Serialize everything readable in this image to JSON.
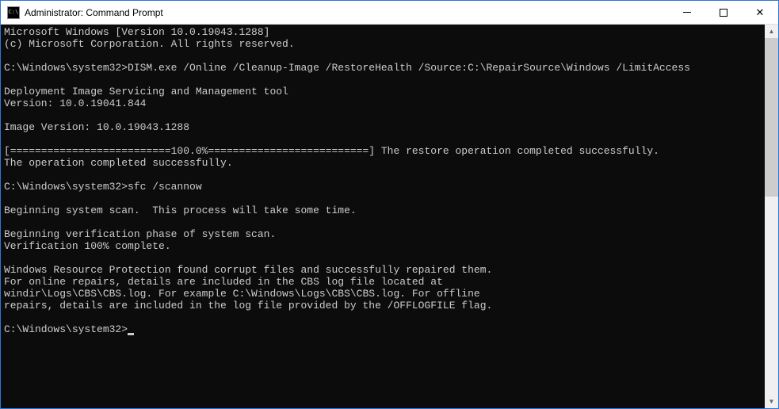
{
  "window": {
    "title": "Administrator: Command Prompt",
    "icon_text": "C:\\"
  },
  "terminal": {
    "lines": [
      "Microsoft Windows [Version 10.0.19043.1288]",
      "(c) Microsoft Corporation. All rights reserved.",
      "",
      "C:\\Windows\\system32>DISM.exe /Online /Cleanup-Image /RestoreHealth /Source:C:\\RepairSource\\Windows /LimitAccess",
      "",
      "Deployment Image Servicing and Management tool",
      "Version: 10.0.19041.844",
      "",
      "Image Version: 10.0.19043.1288",
      "",
      "[==========================100.0%==========================] The restore operation completed successfully.",
      "The operation completed successfully.",
      "",
      "C:\\Windows\\system32>sfc /scannow",
      "",
      "Beginning system scan.  This process will take some time.",
      "",
      "Beginning verification phase of system scan.",
      "Verification 100% complete.",
      "",
      "Windows Resource Protection found corrupt files and successfully repaired them.",
      "For online repairs, details are included in the CBS log file located at",
      "windir\\Logs\\CBS\\CBS.log. For example C:\\Windows\\Logs\\CBS\\CBS.log. For offline",
      "repairs, details are included in the log file provided by the /OFFLOGFILE flag.",
      ""
    ],
    "prompt_current": "C:\\Windows\\system32>"
  }
}
